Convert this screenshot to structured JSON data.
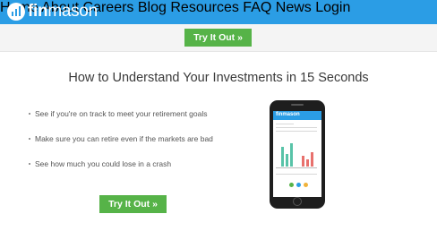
{
  "brand": {
    "name_prefix": "fin",
    "name_suffix": "mason",
    "colors": {
      "header": "#2b9de5",
      "button": "#56b348",
      "band": "#f4f4f4"
    }
  },
  "nav": {
    "items": [
      "Home",
      "About",
      "Careers",
      "Blog",
      "Resources",
      "FAQ",
      "News",
      "Login"
    ]
  },
  "cta": {
    "top_label": "Try It Out »",
    "bottom_label": "Try It Out »"
  },
  "hero": {
    "headline": "How to Understand Your Investments in 15 Seconds",
    "bullets": [
      "See if you're on track to meet your retirement goals",
      "Make sure you can retire even if the markets are bad",
      "See how much you could lose in a crash"
    ]
  },
  "phone": {
    "app_logo": "finmason",
    "icon": "smartphone-app-preview"
  }
}
